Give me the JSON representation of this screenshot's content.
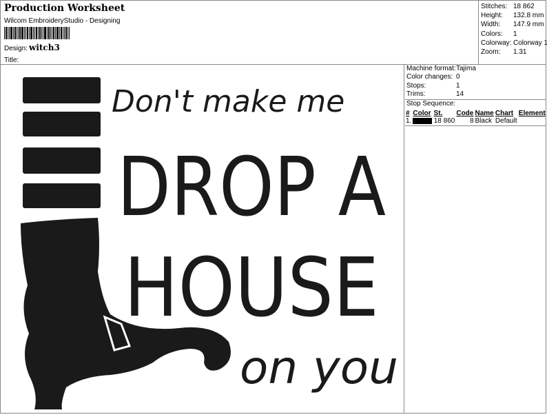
{
  "header": {
    "title": "Production Worksheet",
    "subtitle": "Wilcom EmbroideryStudio - Designing",
    "design_label": "Design:",
    "design_value": "witch3",
    "title_label": "Title:"
  },
  "stats": [
    {
      "label": "Stitches:",
      "value": "18 862"
    },
    {
      "label": "Height:",
      "value": "132.8 mm"
    },
    {
      "label": "Width:",
      "value": "147.9 mm"
    },
    {
      "label": "Colors:",
      "value": "1"
    },
    {
      "label": "Colorway:",
      "value": "Colorway 1"
    },
    {
      "label": "Zoom:",
      "value": "1.31"
    }
  ],
  "machine_info": [
    {
      "label": "Machine format:",
      "value": "Tajima"
    },
    {
      "label": "Color changes:",
      "value": "0"
    },
    {
      "label": "Stops:",
      "value": "1"
    },
    {
      "label": "Trims:",
      "value": "14"
    }
  ],
  "stop_sequence": {
    "label": "Stop Sequence:",
    "columns": [
      "#",
      "Color",
      "St.",
      "Code",
      "Name",
      "Chart",
      "Element"
    ],
    "rows": [
      {
        "num": "1.",
        "color_hex": "#000000",
        "stitches": "18 860",
        "code": "8",
        "name": "Black",
        "chart": "Default",
        "element": ""
      }
    ]
  },
  "design_text": {
    "line1": "Don't make me",
    "line2": "DROP A",
    "line3": "HOUSE",
    "line4": "on you"
  },
  "colors": {
    "thread": "#1a1a1a",
    "border": "#888888"
  }
}
